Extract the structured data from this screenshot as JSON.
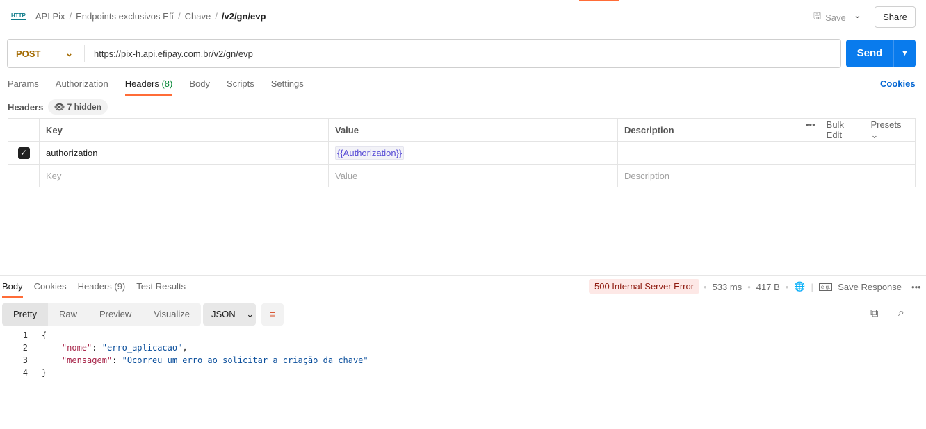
{
  "breadcrumb": {
    "items": [
      "API Pix",
      "Endpoints exclusivos Efí",
      "Chave"
    ],
    "current": "/v2/gn/evp",
    "icon": "http-icon"
  },
  "header": {
    "save": "Save",
    "share": "Share"
  },
  "request": {
    "method": "POST",
    "url": "https://pix-h.api.efipay.com.br/v2/gn/evp",
    "send": "Send"
  },
  "tabs": [
    {
      "label": "Params"
    },
    {
      "label": "Authorization"
    },
    {
      "label": "Headers",
      "count": "(8)"
    },
    {
      "label": "Body"
    },
    {
      "label": "Scripts"
    },
    {
      "label": "Settings"
    }
  ],
  "cookies": "Cookies",
  "headers": {
    "label": "Headers",
    "hidden": "7 hidden",
    "columns": [
      "Key",
      "Value",
      "Description"
    ],
    "bulk_edit": "Bulk Edit",
    "presets": "Presets",
    "rows": [
      {
        "checked": true,
        "key": "authorization",
        "value": "{{Authorization}}",
        "description": ""
      }
    ],
    "placeholder": {
      "key": "Key",
      "value": "Value",
      "description": "Description"
    }
  },
  "response": {
    "tabs": [
      "Body",
      "Cookies",
      "Headers (9)",
      "Test Results"
    ],
    "status": "500 Internal Server Error",
    "time": "533 ms",
    "size": "417 B",
    "save_response": "Save Response",
    "views": [
      "Pretty",
      "Raw",
      "Preview",
      "Visualize"
    ],
    "format": "JSON",
    "lines": [
      "1",
      "2",
      "3",
      "4"
    ],
    "body": {
      "open": "{",
      "k1": "\"nome\"",
      "v1": "\"erro_aplicacao\"",
      "k2": "\"mensagem\"",
      "v2": "\"Ocorreu um erro ao solicitar a criação da chave\"",
      "close": "}"
    }
  },
  "colors": {
    "accent": "#ff6c37",
    "send": "#097bed",
    "error_bg": "#fde8e6"
  }
}
